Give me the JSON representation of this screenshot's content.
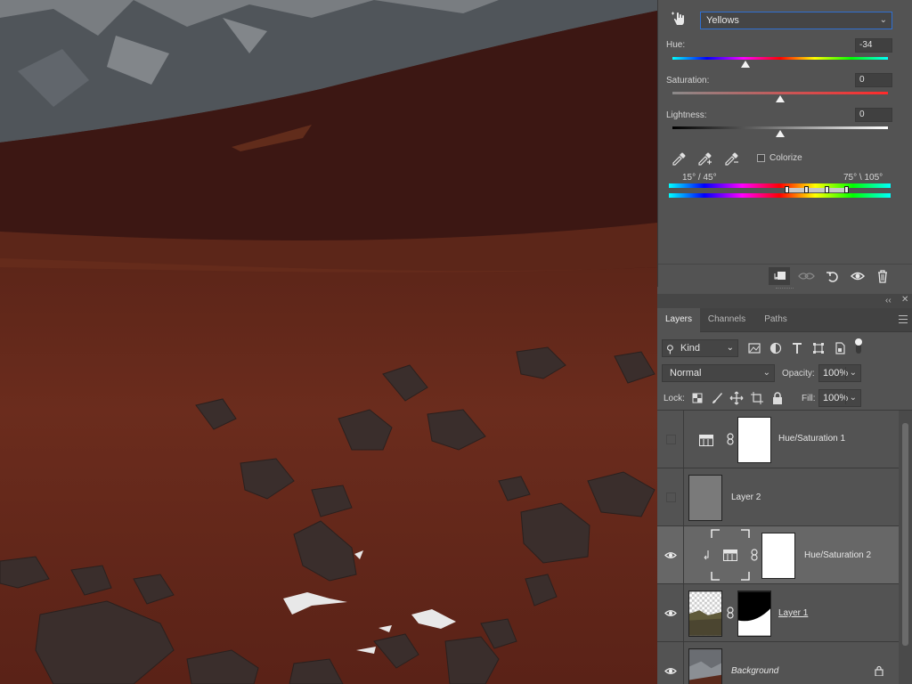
{
  "properties": {
    "preset": "Yellows",
    "hue": {
      "label": "Hue:",
      "value": "-34",
      "position": 0.34
    },
    "saturation": {
      "label": "Saturation:",
      "value": "0",
      "position": 0.5
    },
    "lightness": {
      "label": "Lightness:",
      "value": "0",
      "position": 0.5
    },
    "colorize_label": "Colorize",
    "range_left": "15° /  45°",
    "range_right": "75° \\ 105°"
  },
  "layers_panel": {
    "tabs": [
      {
        "label": "Layers",
        "active": true
      },
      {
        "label": "Channels",
        "active": false
      },
      {
        "label": "Paths",
        "active": false
      }
    ],
    "filter_kind": "Kind",
    "blend_mode": "Normal",
    "opacity_label": "Opacity:",
    "opacity_value": "100%",
    "lock_label": "Lock:",
    "fill_label": "Fill:",
    "fill_value": "100%",
    "layers": [
      {
        "name": "Hue/Saturation 1",
        "visible": false,
        "type": "adjustment"
      },
      {
        "name": "Layer 2",
        "visible": false,
        "type": "fill"
      },
      {
        "name": "Hue/Saturation 2",
        "visible": true,
        "type": "adjustment-clipped",
        "selected": true
      },
      {
        "name": "Layer 1",
        "visible": true,
        "type": "image-masked"
      },
      {
        "name": "Background",
        "visible": true,
        "type": "background",
        "locked": true
      }
    ]
  },
  "colors": {
    "panel_bg": "#535353",
    "selected_row": "#676767",
    "focus_blue": "#2f6fd0"
  }
}
